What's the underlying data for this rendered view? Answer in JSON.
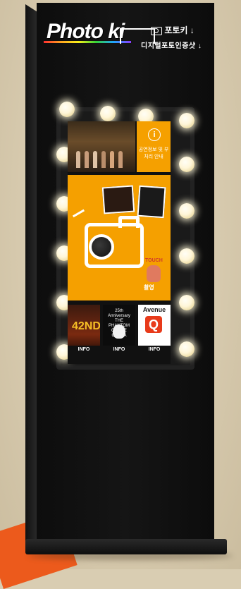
{
  "header": {
    "logo_text": "Photo ki",
    "brand_korean": "포토키 ↓",
    "subtitle_korean": "디지털포토인증샷 ↓"
  },
  "screen": {
    "info_tile": {
      "icon": "info-icon",
      "text": "공연정보 및 부처리 안내"
    },
    "camera_tile": {
      "icon": "camera-icon",
      "touch_top": "TOUCH",
      "touch_label": "촬영"
    },
    "shows": [
      {
        "title": "42ND",
        "label": "INFO"
      },
      {
        "title": "25th Anniversary THE PHANTOM OF THE OPERA",
        "label": "INFO"
      },
      {
        "title": "Avenue",
        "logo_letter": "Q",
        "label": "INFO"
      }
    ]
  },
  "colors": {
    "accent": "#f5a000",
    "kiosk": "#111111",
    "background": "#d9cdb2"
  }
}
